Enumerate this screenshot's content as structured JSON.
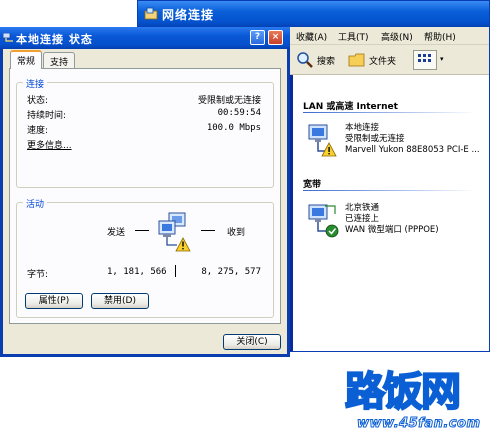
{
  "network_window": {
    "title": "网络连接",
    "menu": [
      "收藏(A)",
      "工具(T)",
      "高级(N)",
      "帮助(H)"
    ],
    "toolbar": {
      "search": "搜索",
      "folders": "文件夹"
    },
    "groups": [
      {
        "title": "LAN 或高速 Internet",
        "items": [
          {
            "name": "本地连接",
            "status": "受限制或无连接",
            "device": "Marvell Yukon 88E8053 PCI-E ..."
          }
        ]
      },
      {
        "title": "宽带",
        "items": [
          {
            "name": "北京铁通",
            "status": "已连接上",
            "device": "WAN 微型端口 (PPPOE)"
          }
        ]
      }
    ]
  },
  "dialog": {
    "title": "本地连接 状态",
    "help_btn": "?",
    "close_btn": "×",
    "tabs": [
      "常规",
      "支持"
    ],
    "connection": {
      "legend": "连接",
      "status_label": "状态:",
      "status_value": "受限制或无连接",
      "duration_label": "持续时间:",
      "duration_value": "00:59:54",
      "speed_label": "速度:",
      "speed_value": "100.0 Mbps",
      "more_info": "更多信息..."
    },
    "activity": {
      "legend": "活动",
      "sent_label": "发送",
      "received_label": "收到",
      "bytes_label": "字节:",
      "bytes_sent": "1, 181, 566",
      "bytes_received": "8, 275, 577"
    },
    "buttons": {
      "properties": "属性(P)",
      "disable": "禁用(D)",
      "close": "关闭(C)"
    }
  },
  "watermark": {
    "brand": "路饭网",
    "site": "www.45fan.com"
  }
}
